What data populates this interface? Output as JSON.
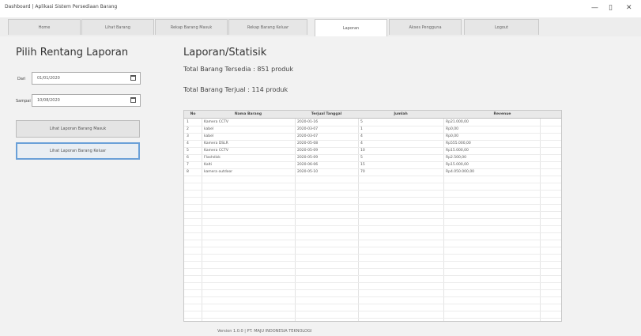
{
  "window": {
    "title": "Dashboard | Aplikasi Sistem Persediaan Barang",
    "minimize": "—",
    "maximize": "▯",
    "close": "✕"
  },
  "tabs": [
    {
      "label": "Home"
    },
    {
      "label": "Lihat Barang"
    },
    {
      "label": "Rekap Barang Masuk"
    },
    {
      "label": "Rekap Barang Keluar"
    },
    {
      "label": "Laporan"
    },
    {
      "label": "Akses Pengguna"
    },
    {
      "label": "Logout"
    }
  ],
  "active_tab": "Laporan",
  "left": {
    "title": "Pilih Rentang Laporan",
    "from_label": "Dari",
    "from_value": "01/01/2020",
    "to_label": "Sampai",
    "to_value": "10/08/2020",
    "btn_masuk": "Lihat Laporan Barang Masuk",
    "btn_keluar": "Lihat Laporan Barang Keluar"
  },
  "report": {
    "title": "Laporan/Statisik",
    "total_available": "Total Barang Tersedia : 851 produk",
    "total_sold": "Total Barang Terjual : 114 produk"
  },
  "table": {
    "columns": [
      "No",
      "Nama Barang",
      "Terjual Tanggal",
      "Jumlah",
      "Revenue"
    ],
    "rows": [
      [
        "1",
        "Kamera CCTV",
        "2020-01-16",
        "5",
        "Rp21.000,00"
      ],
      [
        "2",
        "kabel",
        "2020-03-07",
        "1",
        "Rp0,00"
      ],
      [
        "3",
        "kabel",
        "2020-03-07",
        "4",
        "Rp0,00"
      ],
      [
        "4",
        "Kamera DSLR",
        "2020-05-08",
        "4",
        "Rp555.000,00"
      ],
      [
        "5",
        "Kamera CCTV",
        "2020-05-09",
        "10",
        "Rp15.000,00"
      ],
      [
        "6",
        "Flashdisk",
        "2020-05-09",
        "5",
        "Rp2.500,00"
      ],
      [
        "7",
        "Kalti",
        "2020-06-06",
        "15",
        "Rp15.000,00"
      ],
      [
        "8",
        "kamera outdoor",
        "2020-05-10",
        "70",
        "Rp4.050.000,00"
      ]
    ]
  },
  "footer": "Version 1.0.0 | PT. MAJU INDONESIA TEKNOLOGI"
}
